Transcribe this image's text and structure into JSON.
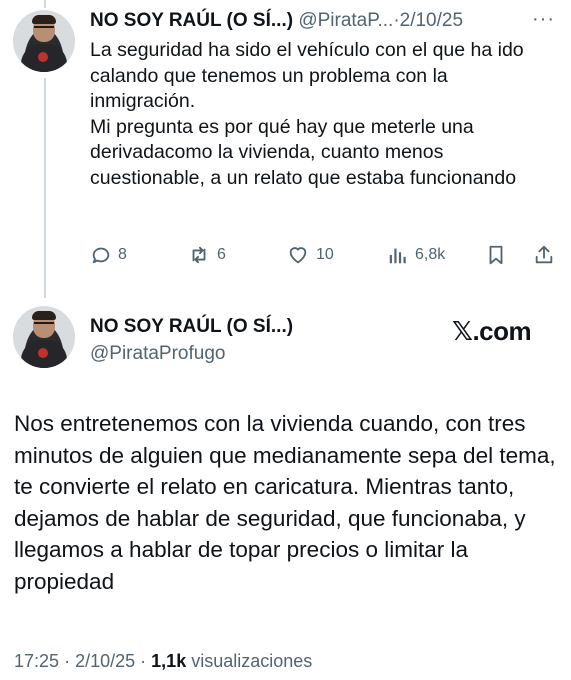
{
  "tweet1": {
    "name": "NO SOY RAÚL (O SÍ...)",
    "handle": "@PirataP...",
    "separator": "·",
    "date": "2/10/25",
    "more": "···",
    "paragraph1": "La seguridad ha sido el vehículo con el que ha ido calando que tenemos un problema con la inmigración.",
    "paragraph2": "Mi pregunta es por qué hay que meterle una derivadacomo la vivienda, cuanto menos cuestionable, a un relato que estaba funcionando",
    "actions": {
      "replies": "8",
      "reposts": "6",
      "likes": "10",
      "views": "6,8k"
    },
    "icons": [
      "reply-icon",
      "repost-icon",
      "like-icon",
      "views-icon",
      "bookmark-icon",
      "share-icon"
    ]
  },
  "tweet2": {
    "name": "NO SOY RAÚL (O SÍ...)",
    "handle": "@PirataProfugo",
    "brand": "𝕏.com",
    "body": "Nos entretenemos con la vivienda cuando, con tres minutos de alguien que medianamente sepa del tema, te convierte el relato en caricatura. Mientras tanto, dejamos de hablar de seguridad, que funcionaba, y llegamos a hablar de topar precios o limitar la propiedad",
    "time": "17:25",
    "separator": "·",
    "date": "2/10/25",
    "separator2": "·",
    "views_count": "1,1k",
    "views_label": "visualizaciones"
  },
  "colors": {
    "text": "#0f1419",
    "muted": "#536471",
    "thread_line": "#cfd9de"
  }
}
